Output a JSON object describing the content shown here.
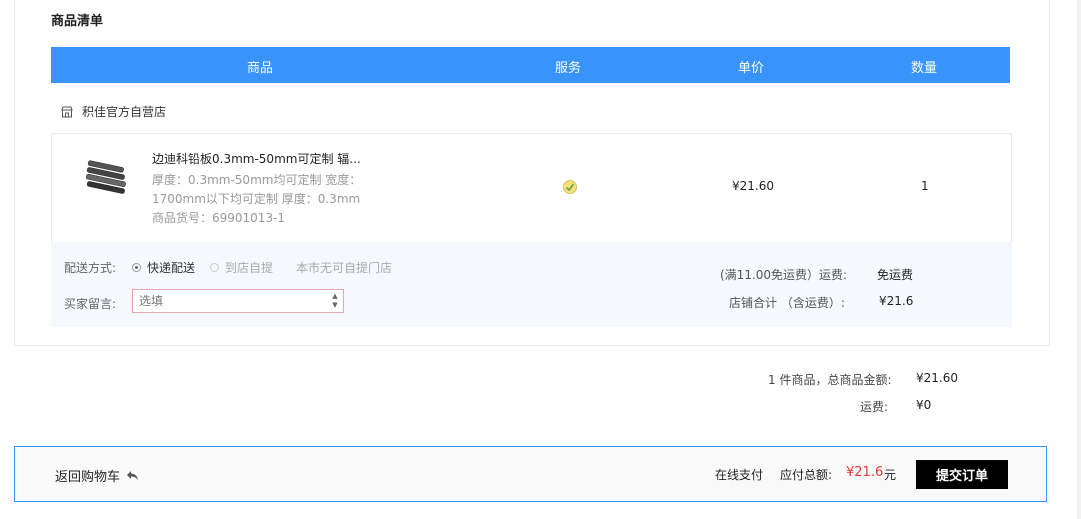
{
  "section_title": "商品清单",
  "table_headers": {
    "product": "商品",
    "service": "服务",
    "unit_price": "单价",
    "quantity": "数量"
  },
  "store": {
    "name": "积佳官方自营店",
    "icon": "store-icon"
  },
  "item": {
    "name": "边迪科铅板0.3mm-50mm可定制 辐...",
    "attr_line1": "厚度：0.3mm-50mm均可定制 宽度：",
    "attr_line2": "1700mm以下均可定制 厚度：0.3mm",
    "sku": "商品货号：69901013-1",
    "service_icon": "service-badge-icon",
    "unit_price": "¥21.60",
    "quantity": "1"
  },
  "delivery": {
    "label": "配送方式:",
    "option_express": "快递配送",
    "option_pickup": "到店自提",
    "pickup_note": "本市无可自提门店",
    "selected": "快递配送"
  },
  "message": {
    "label": "买家留言:",
    "placeholder": "选填"
  },
  "shipping": {
    "label": "(满11.00免运费）运费:",
    "value": "免运费"
  },
  "store_total": {
    "label": "店铺合计 （含运费）:",
    "value": "¥21.6"
  },
  "summary": {
    "items_label": "1 件商品，总商品金额:",
    "items_value": "¥21.60",
    "freight_label": "运费:",
    "freight_value": "¥0"
  },
  "bottom": {
    "back_label": "返回购物车",
    "pay_method": "在线支付",
    "total_label": "应付总额:",
    "total_amount": "¥21.6",
    "total_unit": "元",
    "submit_label": "提交订单"
  },
  "colors": {
    "header_bg": "#3893fb",
    "price_red": "#e4393c",
    "submit_bg": "#000000"
  }
}
